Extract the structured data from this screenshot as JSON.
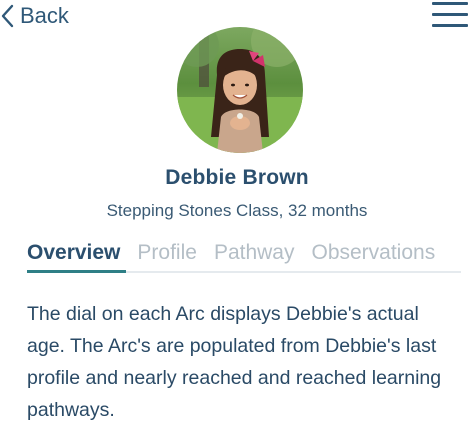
{
  "nav": {
    "back_label": "Back",
    "back_icon": "chevron-left-icon",
    "menu_icon": "hamburger-menu-icon"
  },
  "profile": {
    "avatar_description": "child-photo",
    "name": "Debbie Brown",
    "class_info": "Stepping Stones Class, 32 months"
  },
  "tabs": [
    {
      "label": "Overview",
      "active": true
    },
    {
      "label": "Profile",
      "active": false
    },
    {
      "label": "Pathway",
      "active": false
    },
    {
      "label": "Observations",
      "active": false
    }
  ],
  "overview": {
    "description": "The dial on each Arc displays Debbie's actual age. The Arc's are populated from Debbie's last profile and nearly reached and reached learning pathways."
  },
  "colors": {
    "primary_text": "#2a4a66",
    "inactive_tab": "#b4bec6",
    "active_underline": "#2e7f86"
  }
}
